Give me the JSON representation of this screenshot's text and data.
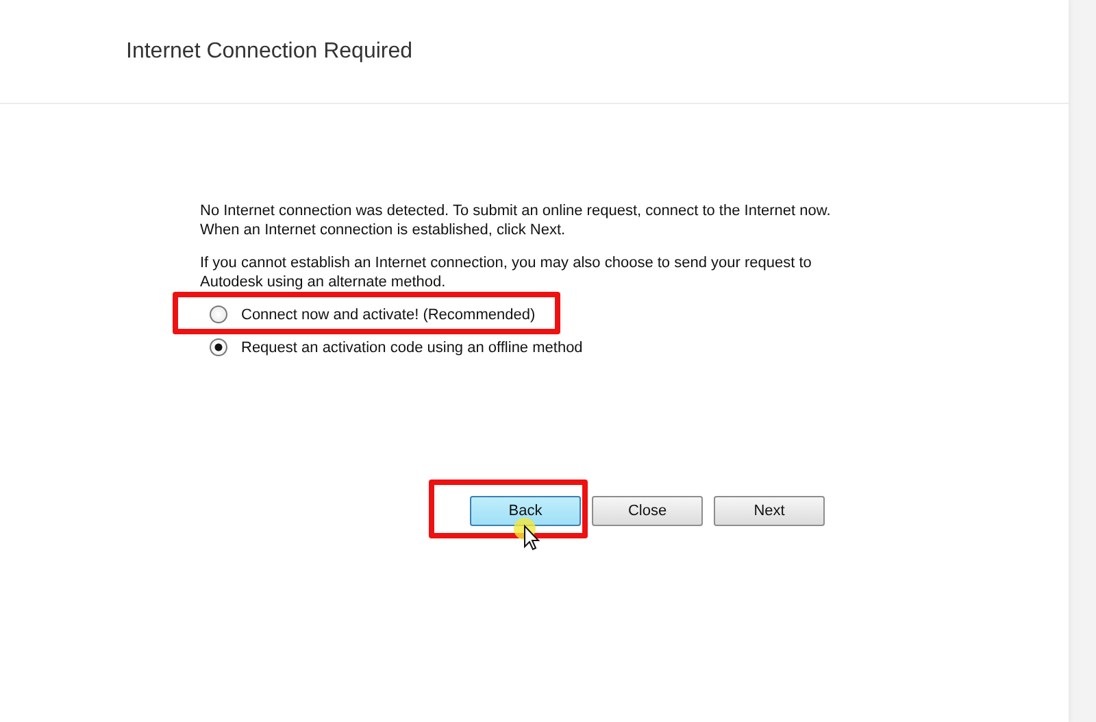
{
  "window": {
    "title": "Internet Connection Required"
  },
  "paragraphs": [
    "No Internet connection was detected. To submit an online request, connect to the Internet now. When an Internet connection is established, click Next.",
    "If you cannot establish an Internet connection, you may also choose to send your request to Autodesk using an alternate method."
  ],
  "options": [
    {
      "label": "Connect now and activate! (Recommended)",
      "selected": false,
      "highlighted": true
    },
    {
      "label": "Request an activation code using an offline method",
      "selected": true,
      "highlighted": false
    }
  ],
  "buttons": [
    {
      "label": "Back",
      "hovered": true,
      "highlighted": true
    },
    {
      "label": "Close",
      "hovered": false,
      "highlighted": false
    },
    {
      "label": "Next",
      "hovered": false,
      "highlighted": false
    }
  ]
}
